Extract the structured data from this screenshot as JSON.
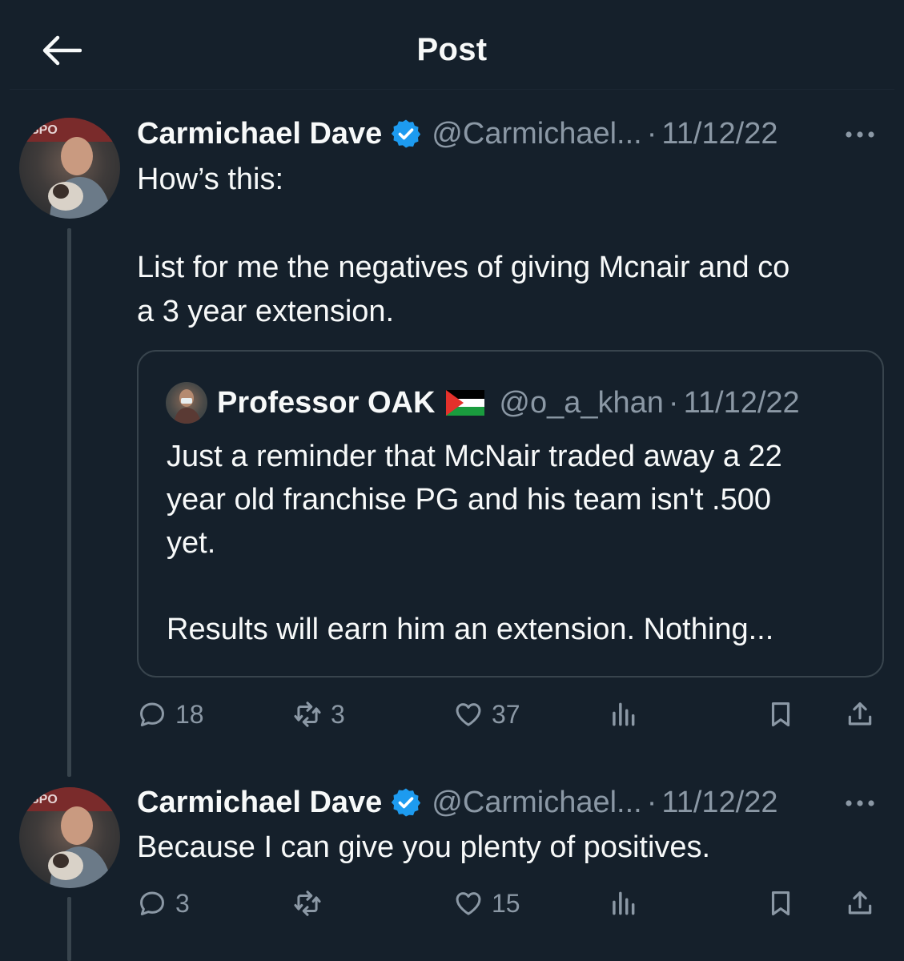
{
  "header": {
    "title": "Post"
  },
  "tweet1": {
    "author_name": "Carmichael Dave",
    "handle": "@Carmichael...",
    "separator": "·",
    "date": "11/12/22",
    "text": "How’s this:\n\nList for me the negatives of giving Mcnair and co\na 3 year extension.",
    "quote": {
      "author_name": "Professor OAK",
      "handle": "@o_a_khan",
      "separator": "·",
      "date": "11/12/22",
      "text": "Just a reminder that McNair traded away a 22\nyear old franchise PG and his team isn't .500\nyet.\n\nResults will earn him an extension. Nothing..."
    },
    "actions": {
      "replies": "18",
      "reposts": "3",
      "likes": "37"
    }
  },
  "tweet2": {
    "author_name": "Carmichael Dave",
    "handle": "@Carmichael...",
    "separator": "·",
    "date": "11/12/22",
    "text": "Because I can give you plenty of positives.",
    "actions": {
      "replies": "3",
      "reposts": "",
      "likes": "15"
    }
  },
  "colors": {
    "background": "#15202b",
    "text_primary": "#f7f9f9",
    "text_secondary": "#8b98a5",
    "border": "#38444d",
    "verified_blue": "#1d9bf0"
  },
  "icons": [
    "back-arrow-icon",
    "verified-badge-icon",
    "more-icon",
    "reply-icon",
    "repost-icon",
    "like-icon",
    "views-icon",
    "bookmark-icon",
    "share-icon",
    "palestine-flag-icon"
  ]
}
